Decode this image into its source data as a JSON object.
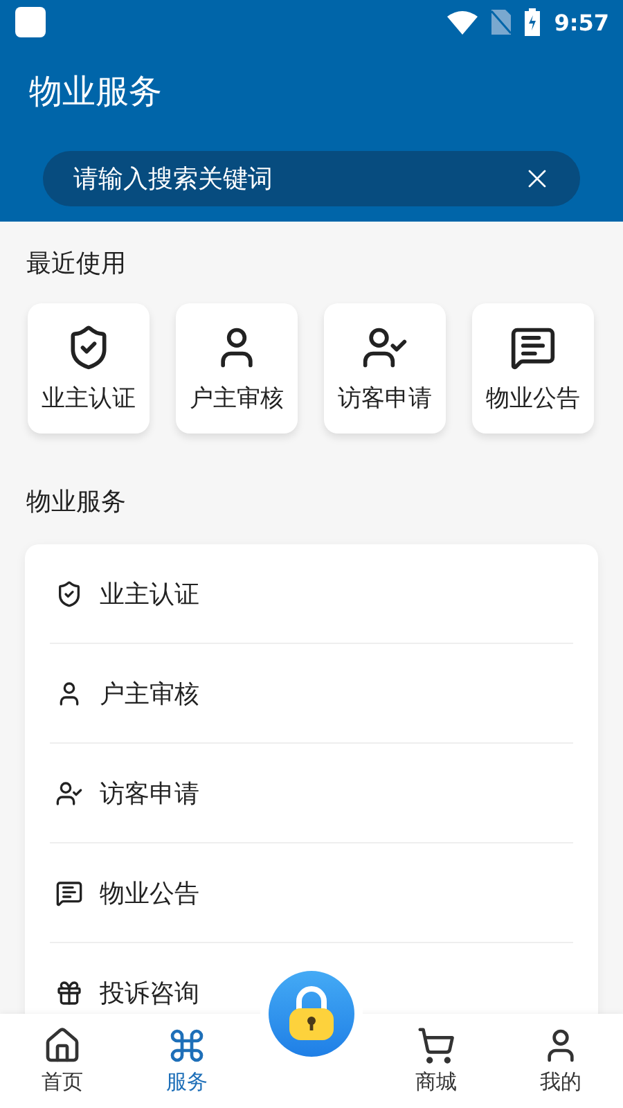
{
  "status_bar": {
    "time": "9:57"
  },
  "header": {
    "title": "物业服务",
    "search": {
      "placeholder": "请输入搜索关键词"
    }
  },
  "recent": {
    "title": "最近使用",
    "items": [
      {
        "label": "业主认证",
        "kind": "shield"
      },
      {
        "label": "户主审核",
        "kind": "user"
      },
      {
        "label": "访客申请",
        "kind": "visitor"
      },
      {
        "label": "物业公告",
        "kind": "notice"
      }
    ]
  },
  "services": {
    "title": "物业服务",
    "items": [
      {
        "label": "业主认证",
        "kind": "shield"
      },
      {
        "label": "户主审核",
        "kind": "user"
      },
      {
        "label": "访客申请",
        "kind": "visitor"
      },
      {
        "label": "物业公告",
        "kind": "notice"
      },
      {
        "label": "投诉咨询",
        "kind": "gift"
      }
    ]
  },
  "nav": [
    {
      "label": "首页",
      "kind": "home",
      "selected": false
    },
    {
      "label": "服务",
      "kind": "services",
      "selected": true
    },
    {
      "kind": "center"
    },
    {
      "label": "商城",
      "kind": "cart",
      "selected": false
    },
    {
      "label": "我的",
      "kind": "person",
      "selected": false
    }
  ]
}
